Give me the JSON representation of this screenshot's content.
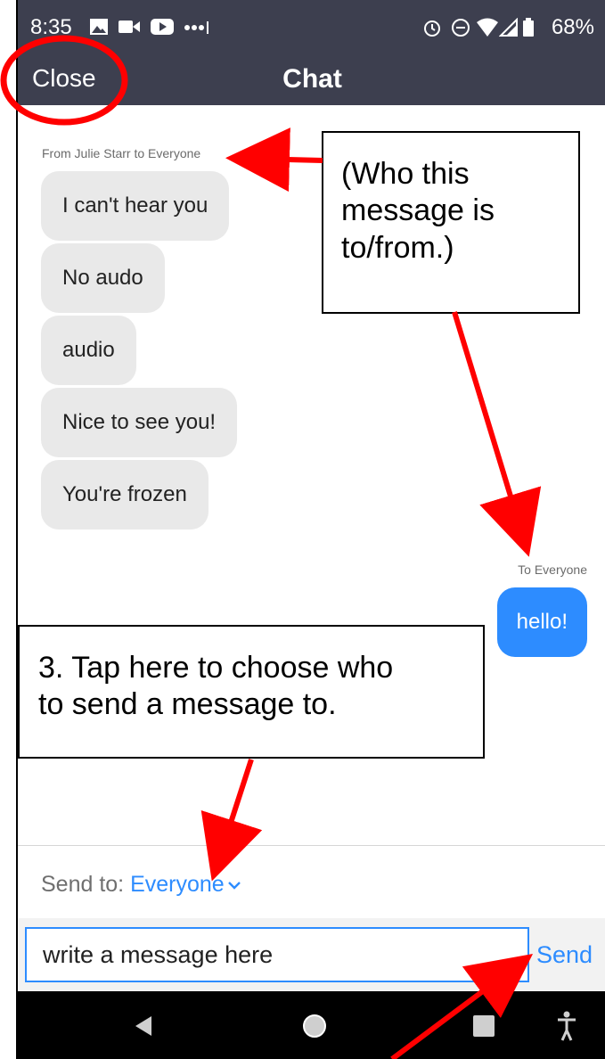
{
  "status_bar": {
    "time": "8:35",
    "battery": "68%"
  },
  "header": {
    "close_label": "Close",
    "title": "Chat"
  },
  "chat": {
    "received_label": "From Julie Starr to Everyone",
    "received_messages": [
      "I can't hear you",
      "No audo",
      "audio",
      "Nice to see you!",
      "You're frozen"
    ],
    "sent_label": "To Everyone",
    "sent_messages": [
      "hello!"
    ]
  },
  "composer": {
    "send_to_prefix": "Send to:",
    "recipient": "Everyone",
    "input_value": "write a message here",
    "send_label": "Send"
  },
  "annotations": {
    "note_1": [
      "(Who this",
      "message is",
      "to/from.)"
    ],
    "note_2": [
      "3. Tap here to choose who",
      "to send a message to."
    ]
  },
  "colors": {
    "header_bg": "#3d3f4f",
    "accent": "#2d8cff",
    "annotation": "#ff0000"
  }
}
